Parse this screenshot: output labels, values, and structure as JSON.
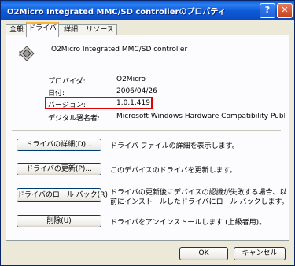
{
  "window": {
    "title": "O2Micro Integrated MMC/SD controllerのプロパティ",
    "help": "?",
    "close": "✕"
  },
  "tabs": [
    {
      "label": "全般"
    },
    {
      "label": "ドライバ"
    },
    {
      "label": "詳細"
    },
    {
      "label": "リソース"
    }
  ],
  "device": {
    "name": "O2Micro Integrated MMC/SD controller",
    "icon": "chip-icon"
  },
  "info": {
    "provider_label": "プロバイダ:",
    "provider": "O2Micro",
    "date_label": "日付:",
    "date": "2006/04/26",
    "version_label": "バージョン:",
    "version": "1.0.1.419",
    "signer_label": "デジタル署名者:",
    "signer": "Microsoft Windows Hardware Compatibility Publishe"
  },
  "actions": {
    "details_button": "ドライバの詳細(D)...",
    "details_desc": "ドライバ ファイルの詳細を表示します。",
    "update_button": "ドライバの更新(P)...",
    "update_desc": "このデバイスのドライバを更新します。",
    "rollback_button": "ドライバのロール バック(R)",
    "rollback_desc_1": "ドライバの更新後にデバイスの認識が失敗する場合、以",
    "rollback_desc_2": "前にインストールしたドライバにロール バックします。",
    "uninstall_button": "削除(U)",
    "uninstall_desc": "ドライバをアンインストールします (上級者用)。"
  },
  "footer": {
    "ok": "OK",
    "cancel": "キャンセル"
  }
}
